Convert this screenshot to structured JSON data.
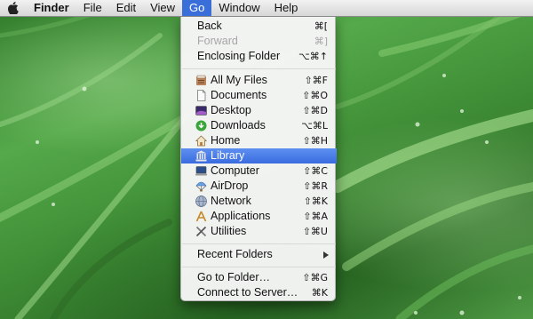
{
  "menubar": {
    "app_name": "Finder",
    "items": [
      "File",
      "Edit",
      "View",
      "Go",
      "Window",
      "Help"
    ]
  },
  "go_menu": {
    "back": {
      "label": "Back",
      "shortcut": "⌘["
    },
    "forward": {
      "label": "Forward",
      "shortcut": "⌘]"
    },
    "enclosing": {
      "label": "Enclosing Folder",
      "shortcut": "⌥⌘↑"
    },
    "all_my_files": {
      "label": "All My Files",
      "shortcut": "⇧⌘F"
    },
    "documents": {
      "label": "Documents",
      "shortcut": "⇧⌘O"
    },
    "desktop": {
      "label": "Desktop",
      "shortcut": "⇧⌘D"
    },
    "downloads": {
      "label": "Downloads",
      "shortcut": "⌥⌘L"
    },
    "home": {
      "label": "Home",
      "shortcut": "⇧⌘H"
    },
    "library": {
      "label": "Library"
    },
    "computer": {
      "label": "Computer",
      "shortcut": "⇧⌘C"
    },
    "airdrop": {
      "label": "AirDrop",
      "shortcut": "⇧⌘R"
    },
    "network": {
      "label": "Network",
      "shortcut": "⇧⌘K"
    },
    "applications": {
      "label": "Applications",
      "shortcut": "⇧⌘A"
    },
    "utilities": {
      "label": "Utilities",
      "shortcut": "⇧⌘U"
    },
    "recent_folders": {
      "label": "Recent Folders"
    },
    "go_to_folder": {
      "label": "Go to Folder…",
      "shortcut": "⇧⌘G"
    },
    "connect_to_server": {
      "label": "Connect to Server…",
      "shortcut": "⌘K"
    }
  },
  "colors": {
    "menu_highlight": "#3a6fd9",
    "wallpaper_green": "#4f9a45"
  }
}
